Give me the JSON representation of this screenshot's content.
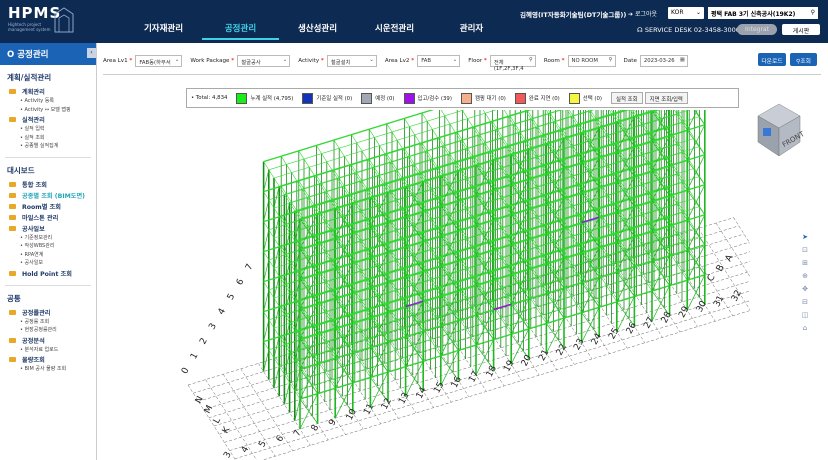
{
  "header": {
    "logo": "HPMS",
    "logo_sub": [
      "Hightech project",
      "management system"
    ],
    "nav": [
      "기자재관리",
      "공정관리",
      "생산성관리",
      "시운전관리",
      "관리자"
    ],
    "user": "김혜영(IT자동화기술팀(DT기술그룹))",
    "logout": "로그아웃",
    "lang": "KOR",
    "project": "평택 FAB 3기 신축공사(19K2)",
    "service_desk": "SERVICE DESK 02-3458-3000 |",
    "integrate": "Integrat",
    "board": "게시판"
  },
  "sidebar": {
    "title": "공정관리",
    "sections": [
      {
        "title": "계획/실적관리",
        "groups": [
          {
            "label": "계획관리",
            "subs": [
              "Activity 등록",
              "Activity ↔ 모델 맵핑"
            ]
          },
          {
            "label": "실적관리",
            "subs": [
              "실적 입력",
              "실적 조회",
              "공종별 실적집계"
            ]
          }
        ]
      },
      {
        "title": "대시보드",
        "groups": [
          {
            "label": "통합 조회",
            "subs": []
          },
          {
            "label": "공종별 조회 (BIM도면)",
            "subs": []
          },
          {
            "label": "Room별 조회",
            "subs": []
          },
          {
            "label": "마일스톤 관리",
            "subs": []
          },
          {
            "label": "공사일보",
            "subs": [
              "기준정보관리",
              "작성WBS관리",
              "RPA연계",
              "공사일보"
            ]
          },
          {
            "label": "Hold Point 조회",
            "subs": []
          }
        ]
      },
      {
        "title": "공통",
        "groups": [
          {
            "label": "공정률관리",
            "subs": [
              "공정률 조회",
              "현장공정률관리"
            ]
          },
          {
            "label": "공정분석",
            "subs": [
              "분석자료 업로드"
            ]
          },
          {
            "label": "물량조회",
            "subs": [
              "BIM 공사 물량 조회"
            ]
          }
        ]
      }
    ]
  },
  "filters": {
    "area_lv1": {
      "label": "Area Lv1",
      "value": "FAB동(하부서"
    },
    "work_package": {
      "label": "Work Package",
      "value": "철골공사"
    },
    "activity": {
      "label": "Activity",
      "value": "철골설치"
    },
    "area_lv2": {
      "label": "Area Lv2",
      "value": "FAB"
    },
    "floor": {
      "label": "Floor",
      "value": "전체(1F,2F,3F,4"
    },
    "room": {
      "label": "Room",
      "value": "NO ROOM"
    },
    "date": {
      "label": "Date",
      "value": "2023-03-26"
    }
  },
  "buttons": {
    "download": "다운로드",
    "search": "조회"
  },
  "legend": {
    "total": "• Total: 4,834",
    "items": [
      {
        "label": "누계 실적 (4,795)",
        "color": "#1aee1a"
      },
      {
        "label": "기준일 실적 (0)",
        "color": "#1333b8"
      },
      {
        "label": "예정 (0)",
        "color": "#a0a8b4"
      },
      {
        "label": "입고/검수 (39)",
        "color": "#a010e8"
      },
      {
        "label": "캠핑 대기 (0)",
        "color": "#f4b08a"
      },
      {
        "label": "완료 지연 (0)",
        "color": "#f05a5a"
      },
      {
        "label": "선택 (0)",
        "color": "#f6f640"
      }
    ],
    "btn_actual": "실적 조회",
    "btn_drawing": "지면 조회/입력"
  },
  "grid": {
    "numbers_left": [
      "0",
      "1",
      "2",
      "3",
      "4",
      "5",
      "6",
      "7"
    ],
    "letters_left": [
      "N",
      "M",
      "L",
      "K"
    ],
    "numbers_front": [
      "32",
      "31",
      "30",
      "29",
      "28",
      "27",
      "26",
      "25",
      "24",
      "23",
      "22",
      "21",
      "20",
      "19",
      "18",
      "17",
      "16",
      "15",
      "14",
      "13",
      "12",
      "11",
      "10",
      "9",
      "8",
      "7",
      "6",
      "5",
      "4",
      "3"
    ],
    "letters_right": [
      "C",
      "B",
      "A"
    ]
  },
  "viewcube": {
    "label": "FRONT"
  }
}
